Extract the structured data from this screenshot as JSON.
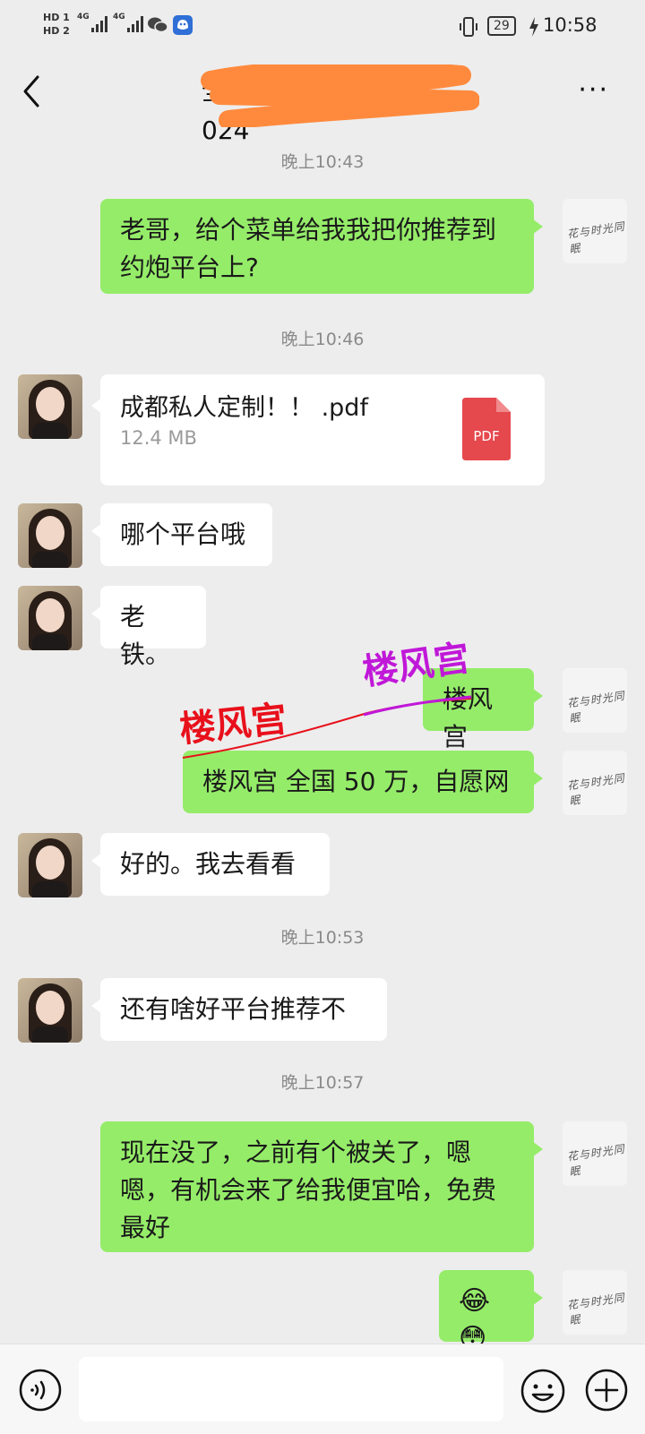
{
  "status_bar": {
    "hd1": "HD 1",
    "hd2": "HD 2",
    "net1": "4G",
    "net2": "4G",
    "battery": "29",
    "time": "10:58"
  },
  "header": {
    "title": "全全■■■■■■■ 024",
    "back_icon": "chevron-left-icon",
    "more_label": "···"
  },
  "messages": {
    "ts1": "晚上10:43",
    "m1": "老哥，给个菜单给我我把你推荐到约炮平台上?",
    "ts2": "晚上10:46",
    "file": {
      "name": "成都私人定制！！ .pdf",
      "size": "12.4 MB",
      "icon_label": "PDF"
    },
    "m3": "哪个平台哦",
    "m4": "老铁。",
    "m5": "楼风宫",
    "m6": "楼风宫 全国 50 万，自愿网",
    "m7": "好的。我去看看",
    "ts3": "晚上10:53",
    "m8": "还有啥好平台推荐不",
    "ts4": "晚上10:57",
    "m9": "现在没了，之前有个被关了，嗯嗯，有机会来了给我便宜哈，免费最好",
    "m10": "😂😳"
  },
  "overlay": {
    "label_red": "楼风宫",
    "label_purple": "楼风宫",
    "red_color": "#e8101b",
    "purple_color": "#c018d8"
  },
  "avatar_signature": "花与时光同眠",
  "colors": {
    "my_bubble": "#95ec69",
    "their_bubble": "#ffffff",
    "background": "#ededed"
  }
}
